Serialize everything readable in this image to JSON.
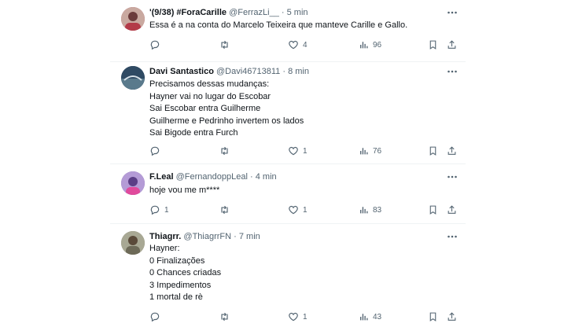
{
  "tweets": [
    {
      "name": "'(9/38) #ForaCarille",
      "handle": "@FerrazLi__",
      "separator": "·",
      "time": "5 min",
      "text": "Essa é a na conta do Marcelo Teixeira que manteve Carille e Gallo.",
      "replies": "",
      "retweets": "",
      "likes": "4",
      "views": "96",
      "avatar_color": "#b84a5a"
    },
    {
      "name": "Davi Santastico",
      "handle": "@Davi46713811",
      "separator": "·",
      "time": "8 min",
      "text": "Precisamos dessas mudanças:\nHayner vai no lugar do Escobar\nSai Escobar entra Guilherme\nGuilherme e Pedrinho invertem os lados\nSai Bigode entra Furch",
      "replies": "",
      "retweets": "",
      "likes": "1",
      "views": "76",
      "avatar_color": "#2f4a63"
    },
    {
      "name": "F.Leal",
      "handle": "@FernandoppLeal",
      "separator": "·",
      "time": "4 min",
      "text": "hoje vou me m****",
      "replies": "1",
      "retweets": "",
      "likes": "1",
      "views": "83",
      "avatar_color": "#7b5fa8"
    },
    {
      "name": "Thiagrr.",
      "handle": "@ThiagrrFN",
      "separator": "·",
      "time": "7 min",
      "text": "Hayner:\n0 Finalizações\n0 Chances criadas\n3 Impedimentos\n1 mortal de rè",
      "replies": "",
      "retweets": "",
      "likes": "1",
      "views": "43",
      "avatar_color": "#8a8a7a"
    }
  ],
  "icons": {
    "reply": "reply-icon",
    "retweet": "retweet-icon",
    "like": "like-icon",
    "views": "views-icon",
    "bookmark": "bookmark-icon",
    "share": "share-icon",
    "more": "more-icon"
  }
}
